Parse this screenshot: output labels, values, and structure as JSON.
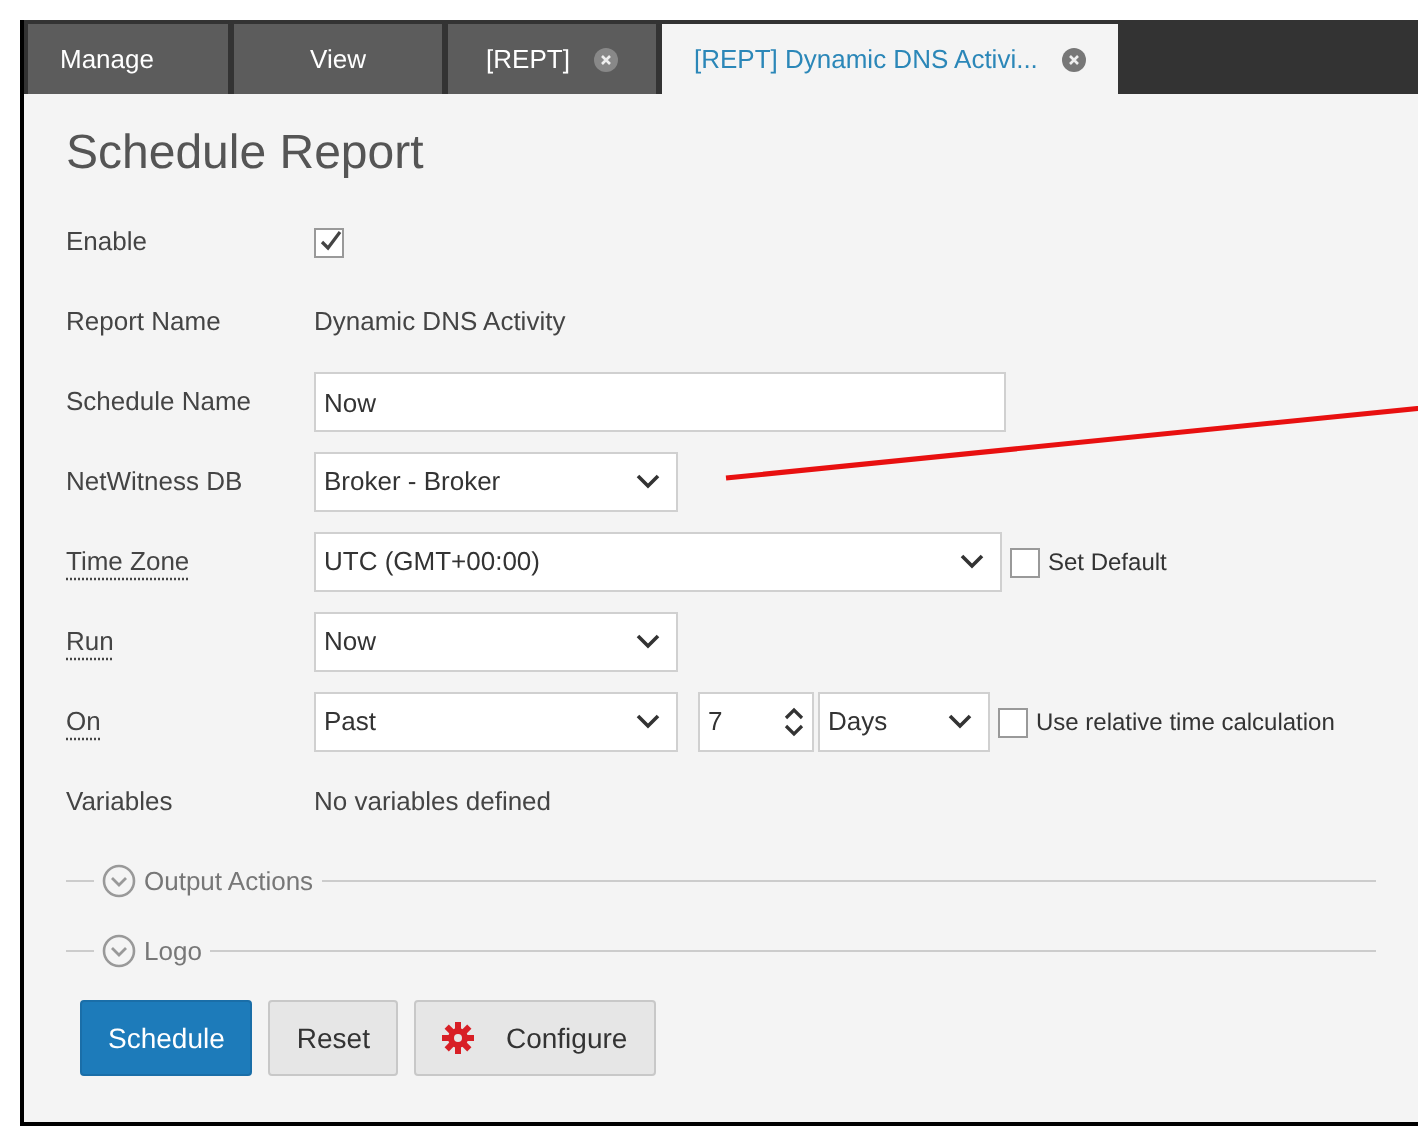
{
  "tabs": [
    {
      "label": "Manage",
      "selected": false,
      "closable": false
    },
    {
      "label": "View",
      "selected": false,
      "closable": false
    },
    {
      "label": "[REPT]",
      "selected": false,
      "closable": true
    },
    {
      "label": "[REPT] Dynamic DNS Activi...",
      "selected": true,
      "closable": true
    }
  ],
  "title": "Schedule Report",
  "rows": [
    {
      "kind": "checkbox",
      "label": "Enable",
      "underlined": false,
      "checked": true
    },
    {
      "kind": "text",
      "label": "Report Name",
      "underlined": false,
      "value": "Dynamic DNS Activity"
    },
    {
      "kind": "input",
      "label": "Schedule Name",
      "underlined": false,
      "value": "Now"
    },
    {
      "kind": "select",
      "label": "NetWitness DB",
      "underlined": false,
      "value": "Broker - Broker"
    },
    {
      "kind": "timezone",
      "label": "Time Zone",
      "underlined": true,
      "value": "UTC (GMT+00:00)",
      "option": {
        "label": "Set Default",
        "checked": false
      }
    },
    {
      "kind": "select",
      "label": "Run",
      "underlined": true,
      "value": "Now"
    },
    {
      "kind": "range",
      "label": "On",
      "underlined": true,
      "value": "Past",
      "number": "7",
      "unit": "Days",
      "option": {
        "label": "Use relative time calculation",
        "checked": false
      }
    },
    {
      "kind": "text",
      "label": "Variables",
      "underlined": false,
      "value": "No variables defined"
    }
  ],
  "sections": [
    {
      "label": "Output Actions",
      "expanded": false
    },
    {
      "label": "Logo",
      "expanded": false
    }
  ],
  "buttons": [
    {
      "label": "Schedule",
      "kind": "primary"
    },
    {
      "label": "Reset",
      "kind": "plain"
    },
    {
      "label": "Configure",
      "kind": "gear"
    }
  ]
}
